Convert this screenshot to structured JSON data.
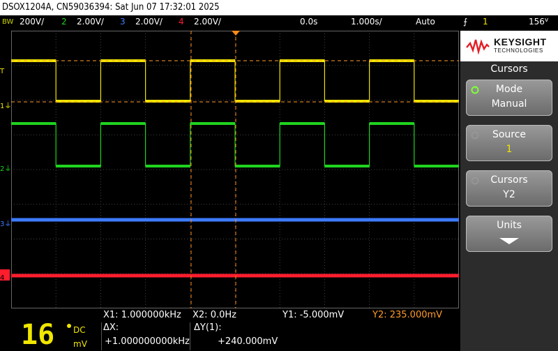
{
  "title": "DSOX1204A, CN59036394: Sat Jun 07 17:32:01 2025",
  "status": {
    "bw": "BW",
    "ch1": "200",
    "ch1_unit": "V/",
    "ch2_num": "2",
    "ch2_scale": "2.00V/",
    "ch3_num": "3",
    "ch3_scale": "2.00V/",
    "ch4_num": "4",
    "ch4_scale": "2.00V/",
    "delay": "0.0s",
    "timebase": "1.000",
    "timebase_unit": "s/",
    "mode": "Auto",
    "trigger_src": "1",
    "trigger_level": "156"
  },
  "brand": {
    "name": "KEYSIGHT",
    "sub": "TECHNOLOGIES"
  },
  "menu": {
    "title": "Cursors",
    "softkeys": [
      {
        "label": "Mode",
        "value": "Manual"
      },
      {
        "label": "Source",
        "value": "1"
      },
      {
        "label": "Cursors",
        "value": "Y2"
      },
      {
        "label": "Units",
        "value": ""
      }
    ]
  },
  "readout": {
    "x1": "X1:  1.000000kHz",
    "x2": "X2:  0.0Hz",
    "y1": "Y1: -5.000mV",
    "y2": "Y2:  235.000mV",
    "meter_value": "16",
    "meter_mode": "DC",
    "meter_unit": "mV",
    "dx_label": "ΔX:",
    "dx_value": "+1.000000000kHz",
    "dy_label": "ΔY(1):",
    "dy_value": "+240.000mV"
  },
  "channel_markers": {
    "t": "T",
    "c1": "1",
    "c2": "2",
    "c3": "3",
    "c4": "4"
  },
  "colors": {
    "ch1": "#f0e600",
    "ch2": "#1fd31f",
    "ch3": "#3d7bff",
    "ch4": "#ff1d2e",
    "cursor_y2": "#ff9b2a",
    "cursor_x": "#ff9b2a"
  },
  "signals": {
    "period_divs": 0.5,
    "duty": 0.5
  }
}
